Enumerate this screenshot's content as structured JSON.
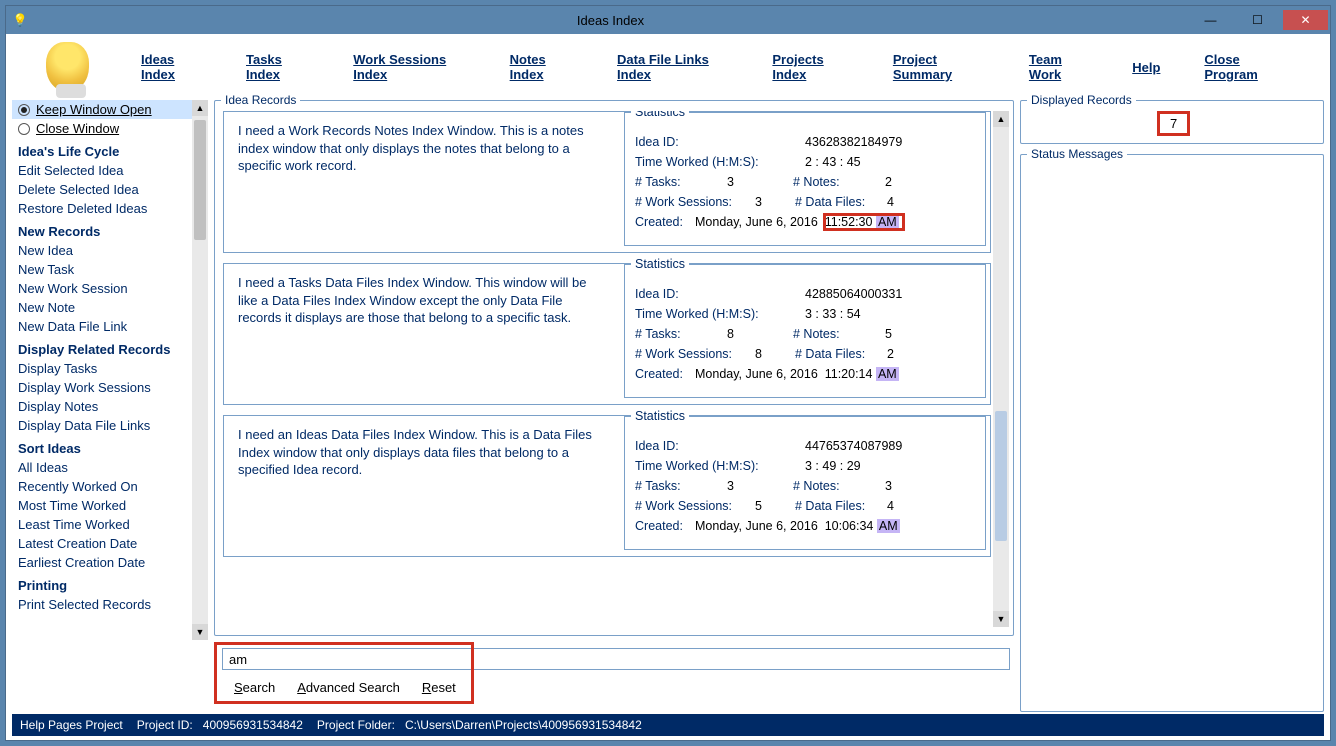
{
  "window": {
    "title": "Ideas Index"
  },
  "nav": {
    "ideas_index": "Ideas Index",
    "tasks_index": "Tasks Index",
    "work_sessions_index": "Work Sessions Index",
    "notes_index": "Notes Index",
    "data_file_links_index": "Data File Links Index",
    "projects_index": "Projects Index",
    "project_summary": "Project Summary",
    "team_work": "Team Work",
    "help": "Help",
    "close_program": "Close Program"
  },
  "sidebar": {
    "keep_window_open": "Keep Window Open",
    "close_window": "Close Window",
    "heads": {
      "life_cycle": "Idea's Life Cycle",
      "new_records": "New Records",
      "display_related": "Display Related Records",
      "sort_ideas": "Sort Ideas",
      "printing": "Printing"
    },
    "life_cycle": {
      "edit": "Edit Selected Idea",
      "delete": "Delete Selected Idea",
      "restore": "Restore Deleted Ideas"
    },
    "new_records": {
      "idea": "New Idea",
      "task": "New Task",
      "work_session": "New Work Session",
      "note": "New Note",
      "data_file_link": "New Data File Link"
    },
    "display_related": {
      "tasks": "Display Tasks",
      "work_sessions": "Display Work Sessions",
      "notes": "Display Notes",
      "data_file_links": "Display Data File Links"
    },
    "sort": {
      "all": "All Ideas",
      "recently": "Recently Worked On",
      "most_time": "Most Time Worked",
      "least_time": "Least Time Worked",
      "latest": "Latest Creation Date",
      "earliest": "Earliest Creation Date"
    },
    "printing": {
      "print_selected": "Print Selected Records"
    }
  },
  "records_legend": "Idea Records",
  "stats_legend": "Statistics",
  "labels": {
    "idea_id": "Idea ID:",
    "time_worked": "Time Worked (H:M:S):",
    "tasks": "# Tasks:",
    "notes": "# Notes:",
    "work_sessions": "# Work Sessions:",
    "data_files": "# Data Files:",
    "created": "Created:"
  },
  "records": [
    {
      "text": "I need a Work Records Notes Index Window. This is a notes index window that only displays the notes that belong to a specific work record.",
      "idea_id": "43628382184979",
      "time_worked": "2  :  43  :  45",
      "tasks": "3",
      "notes": "2",
      "work_sessions": "3",
      "data_files": "4",
      "created_date": "Monday, June 6, 2016",
      "created_time": "11:52:30",
      "created_ampm": "AM",
      "time_redbox": true
    },
    {
      "text": "I need a Tasks Data Files Index Window. This window will be like a Data Files Index Window except the only Data File records it displays are those that belong to a specific task.",
      "idea_id": "42885064000331",
      "time_worked": "3  :  33  :  54",
      "tasks": "8",
      "notes": "5",
      "work_sessions": "8",
      "data_files": "2",
      "created_date": "Monday, June 6, 2016",
      "created_time": "11:20:14",
      "created_ampm": "AM",
      "time_redbox": false
    },
    {
      "text": "I need an Ideas Data Files Index Window. This is a Data Files Index window that only displays data files that belong to a specified Idea record.",
      "idea_id": "44765374087989",
      "time_worked": "3  :  49  :  29",
      "tasks": "3",
      "notes": "3",
      "work_sessions": "5",
      "data_files": "4",
      "created_date": "Monday, June 6, 2016",
      "created_time": "10:06:34",
      "created_ampm": "AM",
      "time_redbox": false
    }
  ],
  "search": {
    "value": "am",
    "search": "Search",
    "advanced": "Advanced Search",
    "reset": "Reset"
  },
  "right": {
    "displayed_legend": "Displayed Records",
    "count": "7",
    "status_legend": "Status Messages"
  },
  "footer": {
    "help_pages": "Help Pages Project",
    "project_id_label": "Project ID:",
    "project_id": "400956931534842",
    "folder_label": "Project Folder:",
    "folder": "C:\\Users\\Darren\\Projects\\400956931534842"
  }
}
